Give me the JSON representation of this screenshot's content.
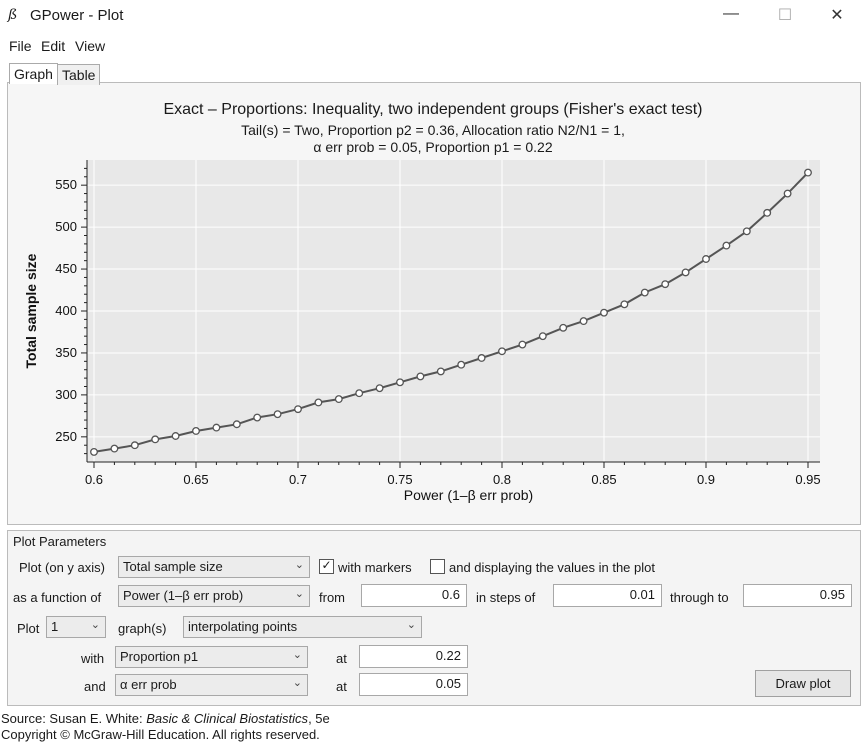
{
  "window": {
    "title": "GPower - Plot",
    "icon": "gpower-app-icon",
    "minimize": "—",
    "maximize": "☐",
    "close": "✕"
  },
  "menu": [
    "File",
    "Edit",
    "View"
  ],
  "tabs": [
    {
      "label": "Graph",
      "active": true
    },
    {
      "label": "Table",
      "active": false
    }
  ],
  "plot": {
    "title": "Exact – Proportions: Inequality, two independent groups (Fisher's exact test)",
    "subtitle1": "Tail(s) = Two, Proportion p2 = 0.36, Allocation ratio N2/N1 = 1,",
    "subtitle2": "α err prob = 0.05, Proportion p1 = 0.22"
  },
  "chart_data": {
    "type": "line",
    "title": "Exact – Proportions: Inequality, two independent groups (Fisher's exact test)",
    "xlabel": "Power (1–β err prob)",
    "ylabel": "Total sample size",
    "xlim": [
      0.6,
      0.95
    ],
    "ylim": [
      220,
      580
    ],
    "xticks": [
      0.6,
      0.65,
      0.7,
      0.75,
      0.8,
      0.85,
      0.9,
      0.95
    ],
    "yticks": [
      250,
      300,
      350,
      400,
      450,
      500,
      550
    ],
    "grid": true,
    "markers": true,
    "color": "#555555",
    "x": [
      0.6,
      0.61,
      0.62,
      0.63,
      0.64,
      0.65,
      0.66,
      0.67,
      0.68,
      0.69,
      0.7,
      0.71,
      0.72,
      0.73,
      0.74,
      0.75,
      0.76,
      0.77,
      0.78,
      0.79,
      0.8,
      0.81,
      0.82,
      0.83,
      0.84,
      0.85,
      0.86,
      0.87,
      0.88,
      0.89,
      0.9,
      0.91,
      0.92,
      0.93,
      0.94,
      0.95
    ],
    "values": [
      232,
      236,
      240,
      247,
      251,
      257,
      261,
      265,
      273,
      277,
      283,
      291,
      295,
      302,
      308,
      315,
      322,
      328,
      336,
      344,
      352,
      360,
      370,
      380,
      388,
      398,
      408,
      422,
      432,
      446,
      462,
      478,
      495,
      517,
      540,
      565
    ]
  },
  "params": {
    "heading": "Plot Parameters",
    "row1": {
      "label": "Plot (on y axis)",
      "combo": "Total sample size",
      "with_markers_label": "with markers",
      "with_markers_checked": true,
      "display_values_label": "and displaying the values in the plot",
      "display_values_checked": false
    },
    "row2": {
      "label": "as a function of",
      "combo": "Power (1–β err prob)",
      "from_label": "from",
      "from_value": "0.6",
      "steps_label": "in steps of",
      "steps_value": "0.01",
      "through_label": "through to",
      "through_value": "0.95"
    },
    "row3": {
      "label": "Plot",
      "count": "1",
      "graphs_label": "graph(s)",
      "mode": "interpolating points"
    },
    "row4": {
      "label": "with",
      "combo": "Proportion p1",
      "at_label": "at",
      "value": "0.22"
    },
    "row5": {
      "label": "and",
      "combo": "α err prob",
      "at_label": "at",
      "value": "0.05"
    },
    "draw_button": "Draw plot"
  },
  "source": {
    "prefix": "Source: Susan E. White: ",
    "book": "Basic & Clinical Biostatistics",
    "edition": ", 5e",
    "copyright": "Copyright © McGraw-Hill Education. All rights reserved."
  }
}
